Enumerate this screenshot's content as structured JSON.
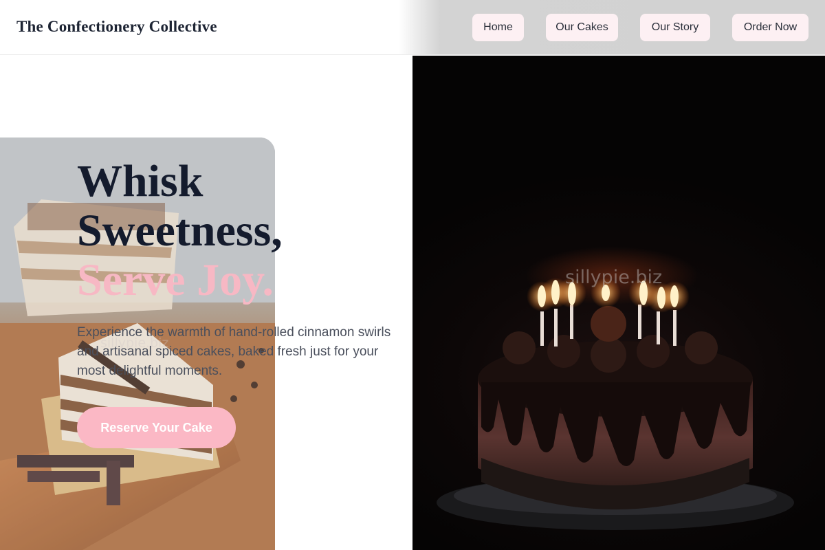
{
  "header": {
    "brand": "The Confectionery Collective",
    "nav": [
      {
        "label": "Home"
      },
      {
        "label": "Our Cakes"
      },
      {
        "label": "Our Story"
      },
      {
        "label": "Order Now"
      }
    ]
  },
  "hero": {
    "title_line1": "Whisk",
    "title_line2": "Sweetness,",
    "title_accent": "Serve Joy.",
    "subtitle": "Experience the warmth of hand-rolled cinnamon swirls and artisanal spiced cakes, baked fresh just for your most delightful moments.",
    "cta_label": "Reserve Your Cake"
  },
  "watermark": "sillypie.biz",
  "colors": {
    "accent_pink": "#f7b8c4",
    "button_pink": "#fbb8c5",
    "nav_button_bg": "#fdf0f3",
    "heading_dark": "#141b2d"
  }
}
